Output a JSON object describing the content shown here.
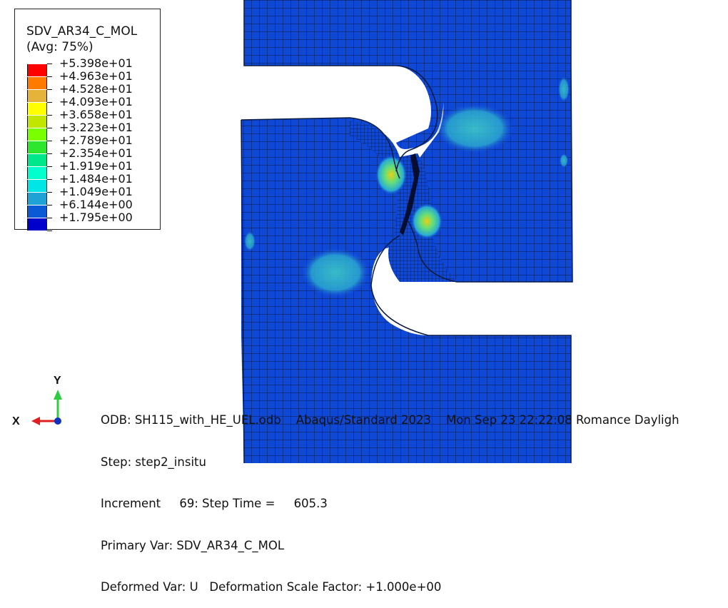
{
  "legend": {
    "title": "SDV_AR34_C_MOL",
    "subtitle": "(Avg: 75%)",
    "entries": [
      {
        "label": "+5.398e+01",
        "color": "#ff0000"
      },
      {
        "label": "+4.963e+01",
        "color": "#ff7a00"
      },
      {
        "label": "+4.528e+01",
        "color": "#e6b33a"
      },
      {
        "label": "+4.093e+01",
        "color": "#ffff00"
      },
      {
        "label": "+3.658e+01",
        "color": "#c2e600"
      },
      {
        "label": "+3.223e+01",
        "color": "#7aff00"
      },
      {
        "label": "+2.789e+01",
        "color": "#2de62d"
      },
      {
        "label": "+2.354e+01",
        "color": "#00e68a"
      },
      {
        "label": "+1.919e+01",
        "color": "#00ffcc"
      },
      {
        "label": "+1.484e+01",
        "color": "#00e6e6"
      },
      {
        "label": "+1.049e+01",
        "color": "#1fa3d6"
      },
      {
        "label": "+6.144e+00",
        "color": "#0a5ad6"
      },
      {
        "label": "+1.795e+00",
        "color": "#0000cc"
      }
    ]
  },
  "triad": {
    "y_label": "Y",
    "x_label": "X",
    "y_color": "#2ecc40",
    "x_color": "#e02020",
    "z_color": "#1030c0"
  },
  "info": {
    "line1": "ODB: SH115_with_HE_UEL.odb    Abaqus/Standard 2023    Mon Sep 23 22:22:08 Romance Dayligh",
    "line2": "Step: step2_insitu",
    "line3": "Increment     69: Step Time =     605.3",
    "line4": "Primary Var: SDV_AR34_C_MOL",
    "line5": "Deformed Var: U   Deformation Scale Factor: +1.000e+00"
  },
  "colors": {
    "mesh_fill": "#1048d6",
    "mesh_line": "#0a1a40",
    "background": "#ffffff"
  }
}
